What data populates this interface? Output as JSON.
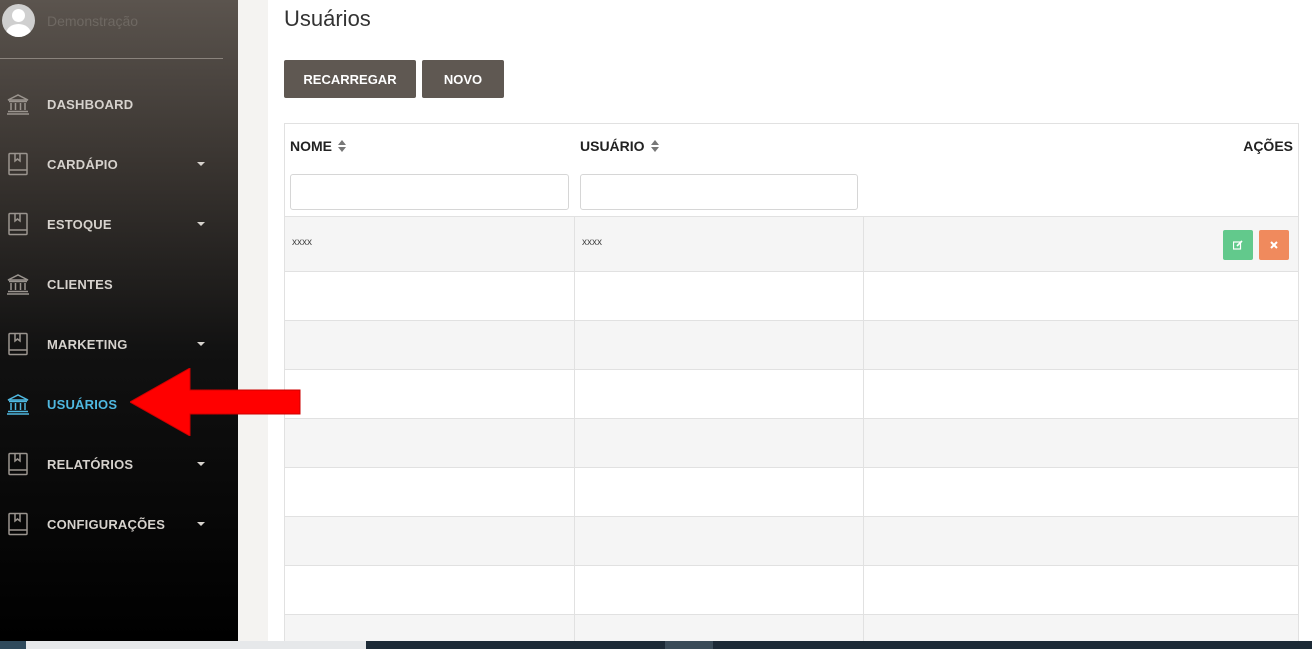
{
  "profile": {
    "name": "Demonstração"
  },
  "sidebar": {
    "items": [
      {
        "label": "DASHBOARD",
        "icon": "bank-icon",
        "has_caret": false
      },
      {
        "label": "CARDÁPIO",
        "icon": "book-icon",
        "has_caret": true
      },
      {
        "label": "ESTOQUE",
        "icon": "book-icon",
        "has_caret": true
      },
      {
        "label": "CLIENTES",
        "icon": "bank-icon",
        "has_caret": false
      },
      {
        "label": "MARKETING",
        "icon": "book-icon",
        "has_caret": true
      },
      {
        "label": "USUÁRIOS",
        "icon": "bank-icon",
        "has_caret": false,
        "active": true
      },
      {
        "label": "RELATÓRIOS",
        "icon": "book-icon",
        "has_caret": true
      },
      {
        "label": "CONFIGURAÇÕES",
        "icon": "book-icon",
        "has_caret": true
      }
    ]
  },
  "main": {
    "title": "Usuários",
    "buttons": {
      "reload": "RECARREGAR",
      "new": "NOVO"
    },
    "table": {
      "columns": [
        "NOME",
        "USUÁRIO",
        "AÇÕES"
      ],
      "rows": [
        {
          "nome": "xxxx",
          "usuario": "xxxx"
        }
      ]
    }
  },
  "colors": {
    "accent_active": "#4fb8e0",
    "button": "#5f5852",
    "edit_button": "#62c98c",
    "delete_button": "#f08a5d",
    "annotation_arrow": "#ff0000"
  }
}
